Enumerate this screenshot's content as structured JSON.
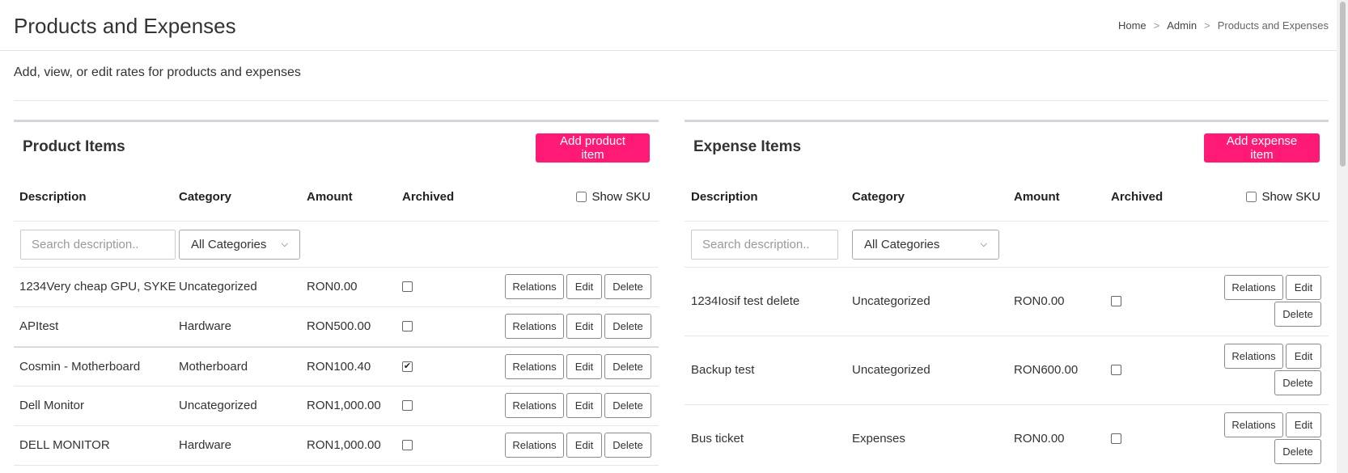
{
  "header": {
    "title": "Products and Expenses",
    "breadcrumb": [
      {
        "label": "Home"
      },
      {
        "label": "Admin"
      },
      {
        "label": "Products and Expenses"
      }
    ]
  },
  "subtitle": "Add, view, or edit rates for products and expenses",
  "products": {
    "title": "Product Items",
    "add_label": "Add product item",
    "columns": {
      "description": "Description",
      "category": "Category",
      "amount": "Amount",
      "archived": "Archived"
    },
    "show_sku_label": "Show SKU",
    "search_placeholder": "Search description..",
    "category_filter": "All Categories",
    "rows": [
      {
        "description": "1234Very cheap GPU, SYKE",
        "category": "Uncategorized",
        "amount": "RON0.00",
        "archived": false
      },
      {
        "description": "APItest",
        "category": "Hardware",
        "amount": "RON500.00",
        "archived": false
      },
      {
        "description": "Cosmin - Motherboard",
        "category": "Motherboard",
        "amount": "RON100.40",
        "archived": true
      },
      {
        "description": "Dell Monitor",
        "category": "Uncategorized",
        "amount": "RON1,000.00",
        "archived": false
      },
      {
        "description": "DELL MONITOR",
        "category": "Hardware",
        "amount": "RON1,000.00",
        "archived": false
      }
    ]
  },
  "expenses": {
    "title": "Expense Items",
    "add_label": "Add expense item",
    "columns": {
      "description": "Description",
      "category": "Category",
      "amount": "Amount",
      "archived": "Archived"
    },
    "show_sku_label": "Show SKU",
    "search_placeholder": "Search description..",
    "category_filter": "All Categories",
    "rows": [
      {
        "description": "1234Iosif test delete",
        "category": "Uncategorized",
        "amount": "RON0.00",
        "archived": false
      },
      {
        "description": "Backup test",
        "category": "Uncategorized",
        "amount": "RON600.00",
        "archived": false
      },
      {
        "description": "Bus ticket",
        "category": "Expenses",
        "amount": "RON0.00",
        "archived": false
      }
    ]
  },
  "row_actions": {
    "relations": "Relations",
    "edit": "Edit",
    "delete": "Delete"
  },
  "icons": {
    "check": "check-icon",
    "chevron": "chevron-down-icon"
  },
  "colors": {
    "accent": "#ff1a75",
    "panel_border": "#d2d6de"
  }
}
